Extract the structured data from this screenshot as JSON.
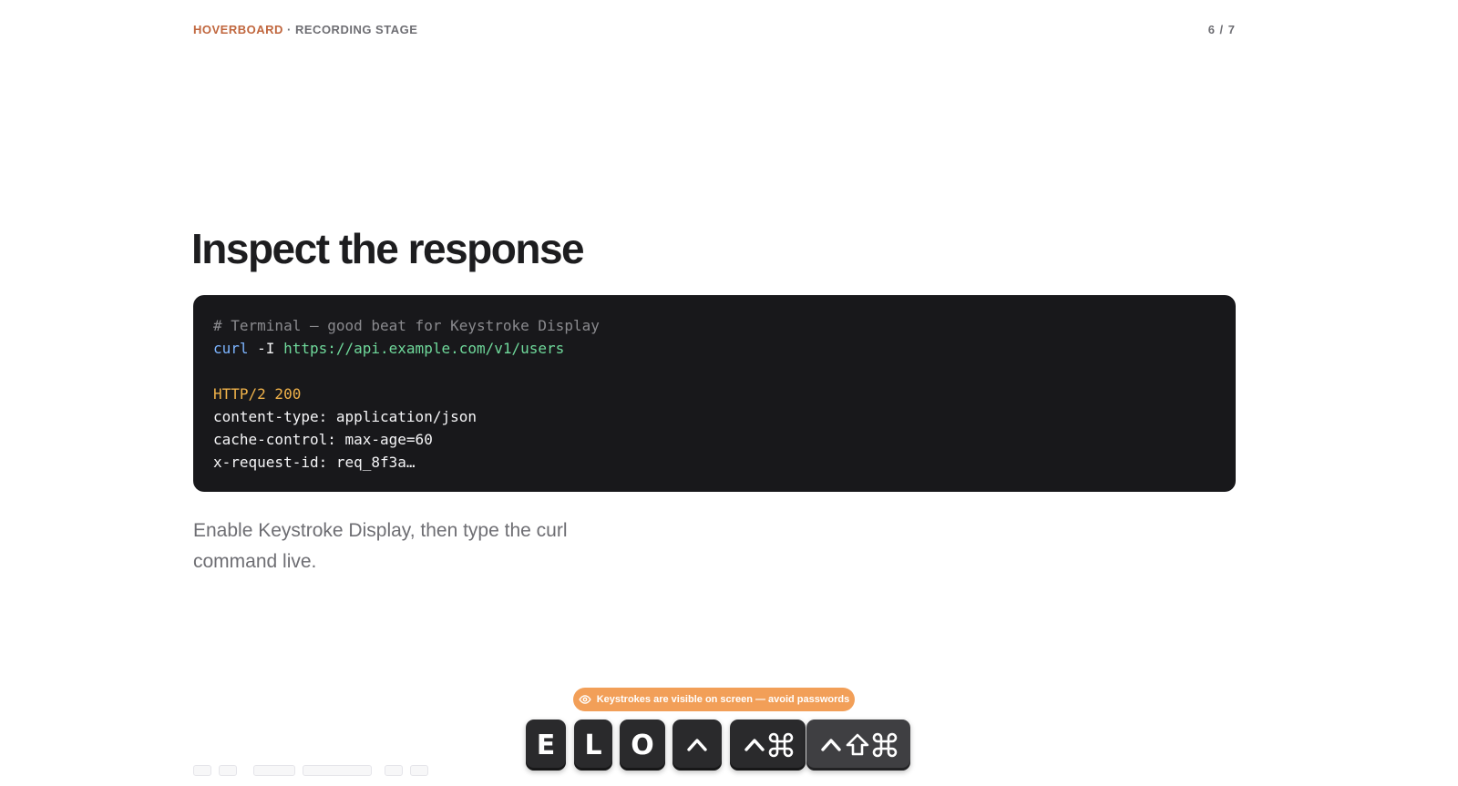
{
  "header": {
    "brand": "HOVERBOARD",
    "separator": "·",
    "stage": "RECORDING STAGE",
    "counter": "6 / 7"
  },
  "slide": {
    "title": "Inspect the response",
    "caption": "Enable Keystroke Display, then type the curl command live."
  },
  "terminal": {
    "comment": "# Terminal — good beat for Keystroke Display",
    "cmd": "curl",
    "flag": " -I ",
    "url": "https://api.example.com/v1/users",
    "status": "HTTP/2 200",
    "headers": [
      "content-type: application/json",
      "cache-control: max-age=60",
      "x-request-id: req_8f3a…"
    ]
  },
  "overlay": {
    "warning": "Keystrokes are visible on screen — avoid passwords",
    "warning_icon": "eye-icon",
    "accent_color": "#f29f58",
    "keys": [
      {
        "label": "E"
      },
      {
        "label": "L"
      },
      {
        "label": "O"
      },
      {
        "label": "",
        "symbols": [
          "control"
        ]
      },
      {
        "label": "",
        "symbols": [
          "control",
          "command"
        ]
      },
      {
        "label": "",
        "symbols": [
          "control",
          "shift",
          "command"
        ]
      }
    ]
  }
}
